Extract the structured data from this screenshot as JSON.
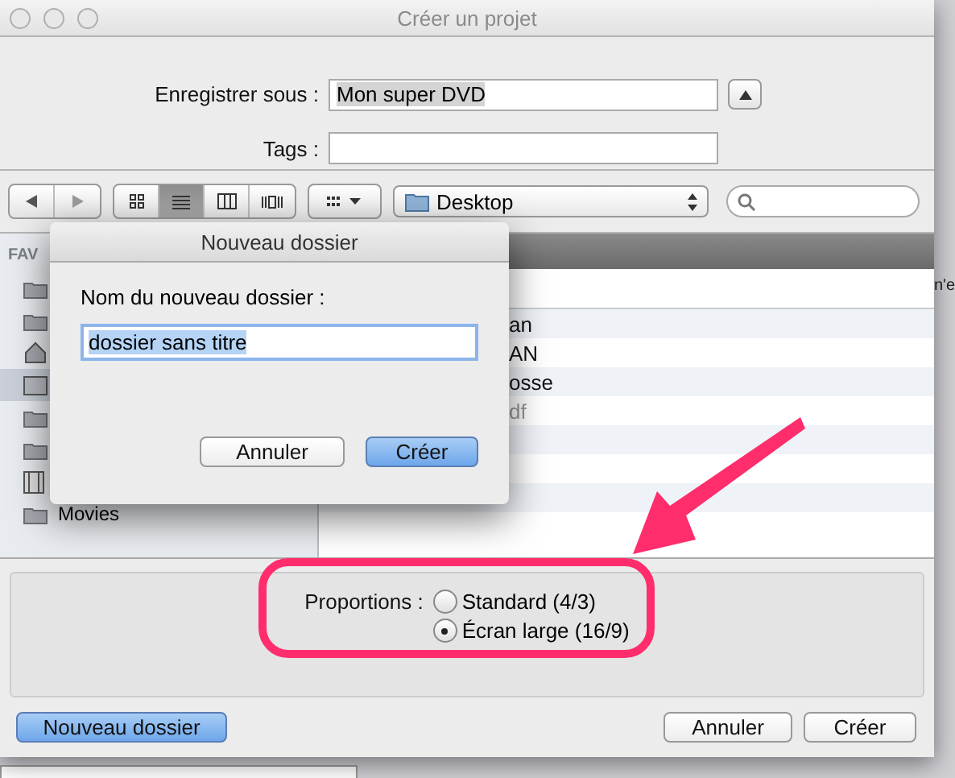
{
  "window": {
    "title": "Créer un projet"
  },
  "save_as": {
    "label": "Enregistrer sous :",
    "value": "Mon super DVD"
  },
  "tags": {
    "label": "Tags :"
  },
  "view_modes": [
    {
      "kind": "icons",
      "selected": false
    },
    {
      "kind": "list",
      "selected": true
    },
    {
      "kind": "columns",
      "selected": false
    },
    {
      "kind": "coverflow",
      "selected": false
    }
  ],
  "location": "Desktop",
  "sidebar": {
    "header": "FAV",
    "items": [
      {
        "kind": "folder",
        "selected": false
      },
      {
        "kind": "folder",
        "selected": false
      },
      {
        "kind": "home",
        "selected": false
      },
      {
        "kind": "desktop",
        "selected": true
      },
      {
        "kind": "folder",
        "selected": false
      },
      {
        "kind": "folder",
        "selected": false
      },
      {
        "kind": "film",
        "selected": false
      },
      {
        "kind": "folder",
        "label": "Movies",
        "selected": false
      }
    ]
  },
  "file_rows": [
    {
      "name": "an",
      "disabled": false
    },
    {
      "name": "AN",
      "disabled": false
    },
    {
      "name": "osse",
      "disabled": false
    },
    {
      "name": "df",
      "disabled": true
    },
    {},
    {},
    {}
  ],
  "new_folder_sheet": {
    "title": "Nouveau dossier",
    "label": "Nom du nouveau dossier :",
    "value": "dossier sans titre",
    "buttons": [
      {
        "label": "Annuler",
        "default": false
      },
      {
        "label": "Créer",
        "default": true
      }
    ]
  },
  "proportions": {
    "label": "Proportions :",
    "options": [
      {
        "label": "Standard (4/3)",
        "selected": false
      },
      {
        "label": "Écran large (16/9)",
        "selected": true
      }
    ]
  },
  "buttons": [
    {
      "label": "Nouveau dossier",
      "default": true
    },
    {
      "label": "Annuler",
      "default": false
    },
    {
      "label": "Créer",
      "default": false
    }
  ],
  "background_text": "n'e"
}
